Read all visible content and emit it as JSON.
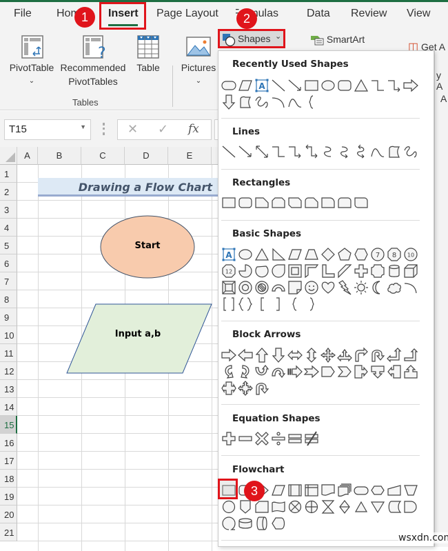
{
  "tabs": [
    {
      "label": "File"
    },
    {
      "label": "Home"
    },
    {
      "label": "Insert",
      "active": true
    },
    {
      "label": "Page Layout"
    },
    {
      "label": "Formulas"
    },
    {
      "label": "Data"
    },
    {
      "label": "Review"
    },
    {
      "label": "View"
    }
  ],
  "ribbon": {
    "pivottable": "PivotTable",
    "recommended_line1": "Recommended",
    "recommended_line2": "PivotTables",
    "table": "Table",
    "pictures": "Pictures",
    "shapes": "Shapes",
    "smartart": "SmartArt",
    "get_addins": "Get A",
    "my_addins": "y A",
    "addins_group": "A",
    "group_tables": "Tables"
  },
  "formula_bar": {
    "name_box": "T15",
    "fx": "fx",
    "formula": ""
  },
  "sheet": {
    "columns": [
      "A",
      "B",
      "C",
      "D",
      "E"
    ],
    "rows": [
      "1",
      "2",
      "3",
      "4",
      "5",
      "6",
      "7",
      "8",
      "9",
      "10",
      "11",
      "12",
      "13",
      "14",
      "15",
      "16",
      "17",
      "18",
      "19",
      "20",
      "21"
    ],
    "selected_row": "15",
    "title": "Drawing a Flow Chart",
    "shapes": [
      {
        "type": "oval",
        "label": "Start",
        "fill": "#f8cbad"
      },
      {
        "type": "parallelogram",
        "label": "Input a,b",
        "fill": "#e2efda"
      }
    ]
  },
  "callouts": [
    "1",
    "2",
    "3"
  ],
  "shapes_menu": {
    "sections": [
      {
        "title": "Recently Used Shapes"
      },
      {
        "title": "Lines"
      },
      {
        "title": "Rectangles"
      },
      {
        "title": "Basic Shapes"
      },
      {
        "title": "Block Arrows"
      },
      {
        "title": "Equation Shapes"
      },
      {
        "title": "Flowchart"
      }
    ],
    "selected_shape": "flowchart-process"
  },
  "accent": "#1e6e42",
  "highlight": "#e0141b",
  "watermark": "wsxdn.com"
}
